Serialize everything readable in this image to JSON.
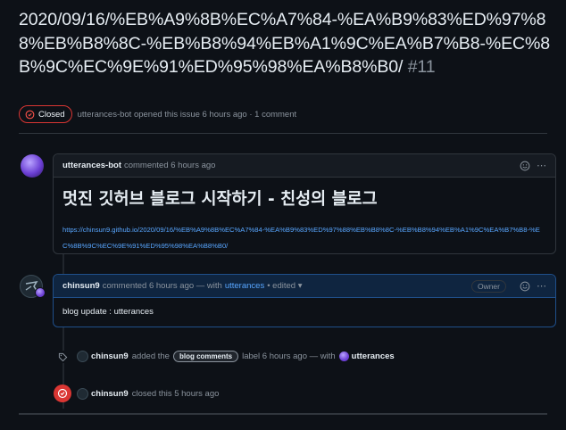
{
  "issue": {
    "title": "2020/09/16/%EB%A9%8B%EC%A7%84-%EA%B9%83%ED%97%88%EB%B8%8C-%EB%B8%94%EB%A1%9C%EA%B7%B8-%EC%8B%9C%EC%9E%91%ED%95%98%EA%B8%B0/",
    "number": "#11",
    "state": "Closed",
    "meta": "utterances-bot opened this issue 6 hours ago · 1 comment"
  },
  "comments": [
    {
      "author": "utterances-bot",
      "meta": "commented 6 hours ago",
      "heading": "멋진 깃허브 블로그 시작하기 - 친성의 블로그",
      "link": "https://chinsun9.github.io/2020/09/16/%EB%A9%8B%EC%A7%84-%EA%B9%83%ED%97%88%EB%B8%8C-%EB%B8%94%EB%A1%9C%EA%B7%B8-%EC%8B%9C%EC%9E%91%ED%95%98%EA%B8%B0/"
    },
    {
      "author": "chinsun9",
      "meta": "commented 6 hours ago — with",
      "app": "utterances",
      "edited": "• edited ▾",
      "owner_badge": "Owner",
      "body": "blog update : utterances"
    }
  ],
  "events": {
    "label_event": {
      "actor": "chinsun9",
      "prefix": "added the",
      "label": "blog comments",
      "suffix": "label 6 hours ago — with",
      "app": "utterances"
    },
    "close_event": {
      "actor": "chinsun9",
      "text": "closed this 5 hours ago"
    }
  },
  "colors": {
    "background": "#0d1117",
    "closed_red": "#da3633",
    "link_blue": "#58a6ff",
    "owner_border": "#1f4f8a"
  }
}
